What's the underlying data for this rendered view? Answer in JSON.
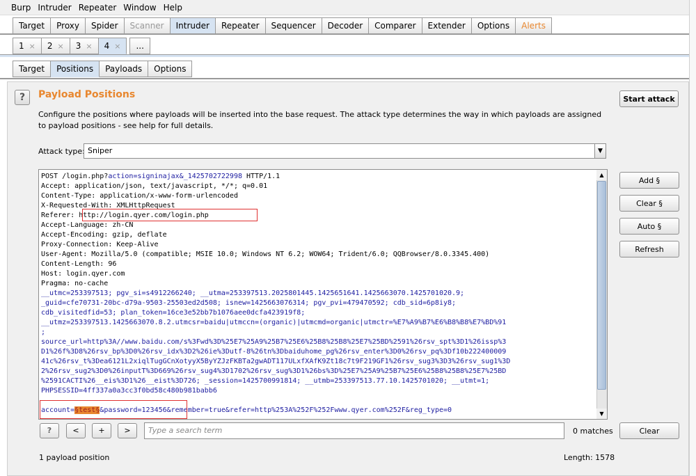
{
  "menubar": [
    "Burp",
    "Intruder",
    "Repeater",
    "Window",
    "Help"
  ],
  "main_tabs": [
    {
      "label": "Target",
      "state": "normal"
    },
    {
      "label": "Proxy",
      "state": "normal"
    },
    {
      "label": "Spider",
      "state": "normal"
    },
    {
      "label": "Scanner",
      "state": "disabled"
    },
    {
      "label": "Intruder",
      "state": "selected"
    },
    {
      "label": "Repeater",
      "state": "normal"
    },
    {
      "label": "Sequencer",
      "state": "normal"
    },
    {
      "label": "Decoder",
      "state": "normal"
    },
    {
      "label": "Comparer",
      "state": "normal"
    },
    {
      "label": "Extender",
      "state": "normal"
    },
    {
      "label": "Options",
      "state": "normal"
    },
    {
      "label": "Alerts",
      "state": "alert"
    }
  ],
  "attack_tabs": [
    {
      "label": "1",
      "close": "×"
    },
    {
      "label": "2",
      "close": "×"
    },
    {
      "label": "3",
      "close": "×"
    },
    {
      "label": "4",
      "close": "×",
      "selected": true
    },
    {
      "label": "...",
      "close": ""
    }
  ],
  "sub_tabs": [
    {
      "label": "Target",
      "selected": false
    },
    {
      "label": "Positions",
      "selected": true
    },
    {
      "label": "Payloads",
      "selected": false
    },
    {
      "label": "Options",
      "selected": false
    }
  ],
  "section": {
    "help": "?",
    "title": "Payload Positions",
    "description": "Configure the positions where payloads will be inserted into the base request. The attack type determines the way in which payloads are assigned to payload positions - see help for full details."
  },
  "buttons": {
    "start_attack": "Start attack",
    "add": "Add §",
    "clear": "Clear §",
    "auto": "Auto §",
    "refresh": "Refresh",
    "clear_search": "Clear"
  },
  "attack_type": {
    "label": "Attack type:",
    "value": "Sniper"
  },
  "request": {
    "line1_a": "POST /login.php?",
    "line1_b": "action=signinajax&_1425702722998",
    "line1_c": " HTTP/1.1",
    "accept": "Accept: application/json, text/javascript, */*; q=0.01",
    "content_type": "Content-Type: application/x-www-form-urlencoded",
    "xrw": "X-Requested-With: XMLHttpRequest",
    "referer_k": "Referer: ",
    "referer_v": "http://login.qyer.com/login.php",
    "accept_lang": "Accept-Language: zh-CN",
    "accept_enc": "Accept-Encoding: gzip, deflate",
    "proxy_conn": "Proxy-Connection: Keep-Alive",
    "user_agent": "User-Agent: Mozilla/5.0 (compatible; MSIE 10.0; Windows NT 6.2; WOW64; Trident/6.0; QQBrowser/8.0.3345.400)",
    "content_length": "Content-Length: 96",
    "host": "Host: login.qyer.com",
    "pragma": "Pragma: no-cache",
    "cookie1": "__utmc=253397513; pgv_si=s4912266240; __utma=253397513.2025801445.1425651641.1425663070.1425701020.9;",
    "cookie2": "_guid=cfe70731-20bc-d79a-9503-25503ed2d508; isnew=1425663076314; pgv_pvi=479470592; cdb_sid=6p8iy8;",
    "cookie3": "cdb_visitedfid=53; plan_token=16ce3e52bb7b1076aee0dcfa423919f8;",
    "cookie4": "__utmz=253397513.1425663070.8.2.utmcsr=baidu|utmccn=(organic)|utmcmd=organic|utmctr=%E7%A9%B7%E6%B8%B8%E7%BD%91",
    "cookie5": ";",
    "cookie6": "source_url=http%3A//www.baidu.com/s%3Fwd%3D%25E7%25A9%25B7%25E6%25B8%25B8%25E7%25BD%2591%26rsv_spt%3D1%26issp%3",
    "cookie7": "D1%26f%3D8%26rsv_bp%3D0%26rsv_idx%3D2%26ie%3Dutf-8%26tn%3Dbaiduhome_pg%26rsv_enter%3D0%26rsv_pq%3Df10b222400009",
    "cookie8": "41c%26rsv_t%3Dea6121L2xiqlTugGCnXotyyX5ByYZJzFKBTa2gwADT117ULxfXAfK9Zt18c7t9F219GF1%26rsv_sug3%3D3%26rsv_sug1%3D",
    "cookie9": "2%26rsv_sug2%3D0%26inputT%3D669%26rsv_sug4%3D1702%26rsv_sug%3D1%26bs%3D%25E7%25A9%25B7%25E6%25B8%25B8%25E7%25BD",
    "cookie10": "%2591CACTI%26__eis%3D1%26__eist%3D726; _session=1425700991814; __utmb=253397513.77.10.1425701020; __utmt=1;",
    "cookie11": "PHPSESSID=4ff337a0a3cc3f0bd58c480b981babb6",
    "body_a": "account=",
    "body_mark": "§test§",
    "body_b": "&password=123456",
    "body_c": "&remember=true&refer=http%253A%252F%252Fwww.qyer.com%252F&reg_type=0"
  },
  "search": {
    "help": "?",
    "prev": "<",
    "add": "+",
    "next": ">",
    "placeholder": "Type a search term",
    "matches": "0 matches"
  },
  "status": {
    "payload_positions": "1 payload position",
    "length": "Length: 1578"
  },
  "colors": {
    "accent_orange": "#e8872f",
    "selected_tab": "#d6e3f2",
    "value_red": "#a01e1e",
    "param_blue": "#1c1ca0",
    "highlight_box": "#e03030"
  }
}
